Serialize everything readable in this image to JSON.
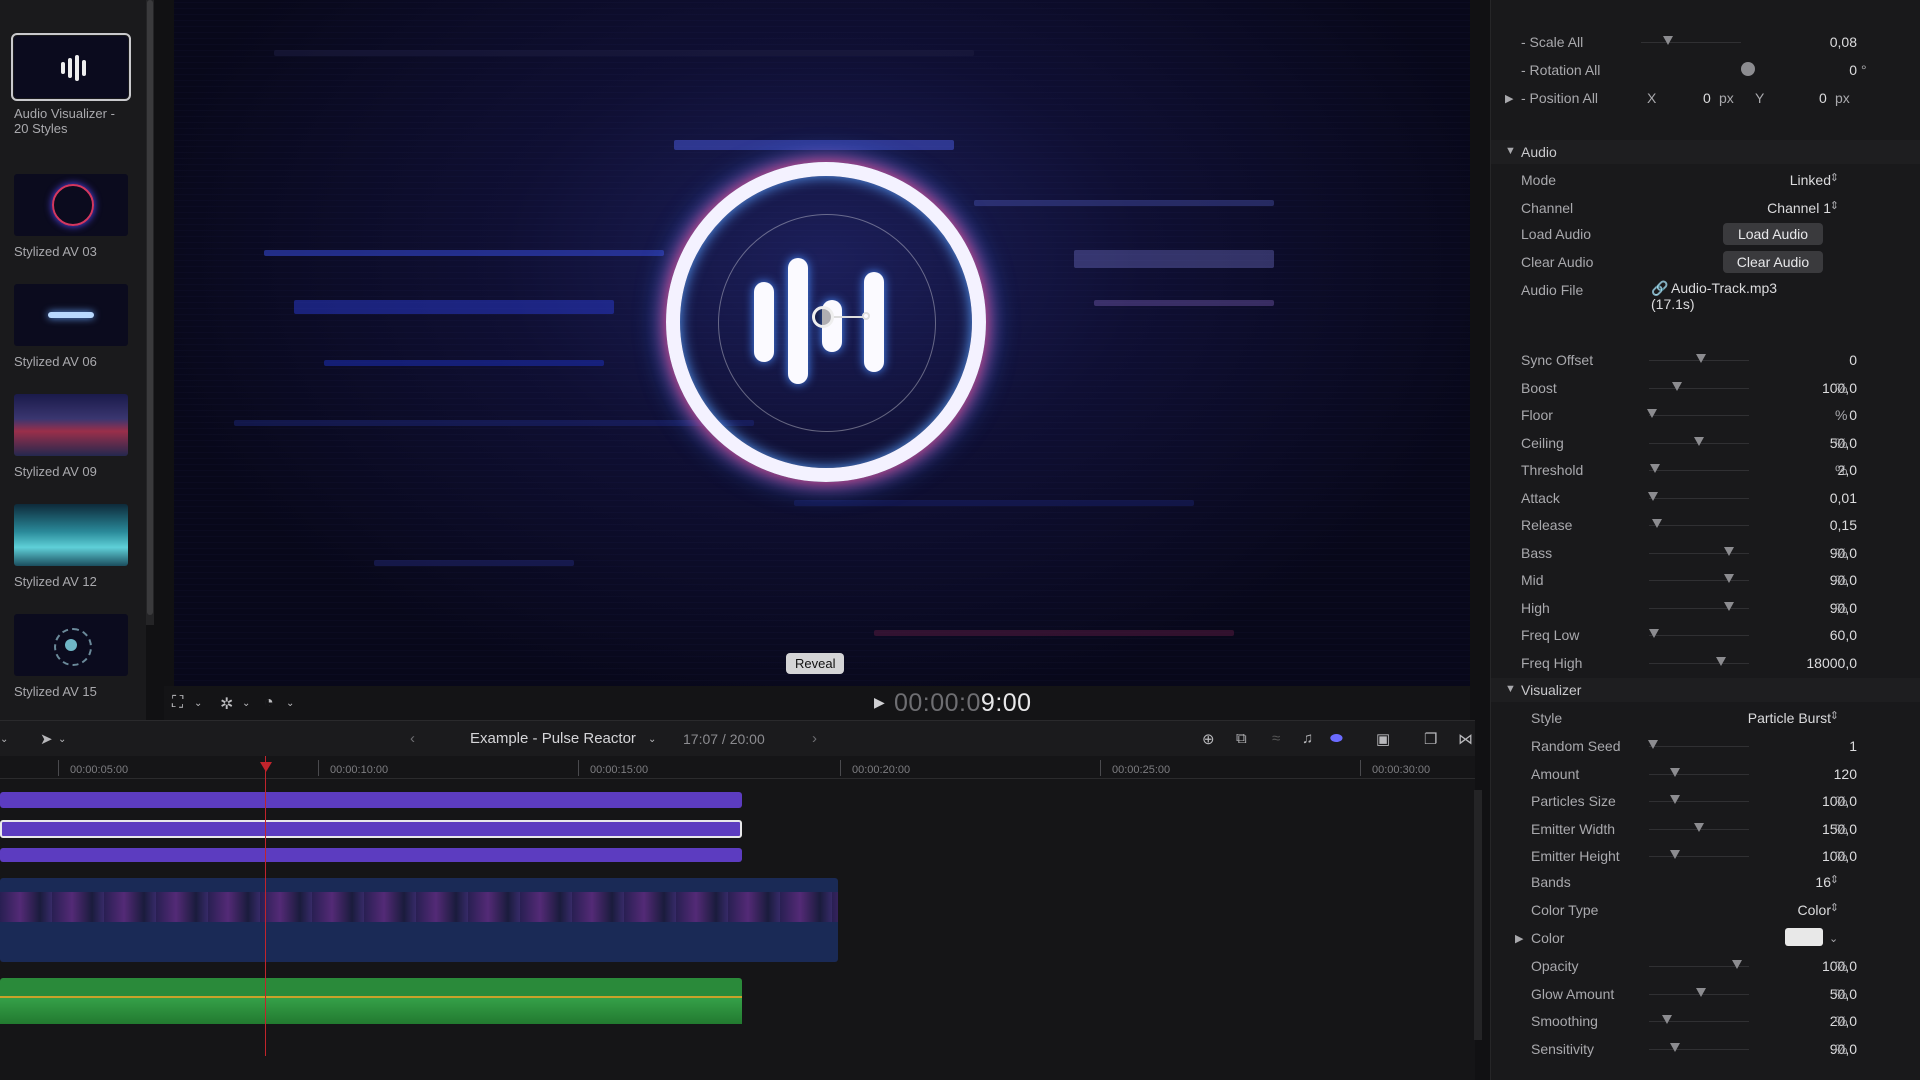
{
  "browser": {
    "items": [
      {
        "label": "Audio Visualizer - 20 Styles"
      },
      {
        "label": "Stylized AV 03"
      },
      {
        "label": "Stylized AV 06"
      },
      {
        "label": "Stylized AV 09"
      },
      {
        "label": "Stylized AV 12"
      },
      {
        "label": "Stylized AV 15"
      }
    ]
  },
  "viewer": {
    "reveal_label": "Reveal",
    "timecode_dim": "00:00:0",
    "timecode_bright": "9:00"
  },
  "timeline_toolbar": {
    "project_name": "Example - Pulse Reactor",
    "duration": "17:07 / 20:00"
  },
  "timeline": {
    "ruler": [
      "00:00:05:00",
      "00:00:10:00",
      "00:00:15:00",
      "00:00:20:00",
      "00:00:25:00",
      "00:00:30:00"
    ]
  },
  "inspector": {
    "top_rows": [
      {
        "label": "- Scale All",
        "value": "0,08",
        "unit": ""
      },
      {
        "label": "- Rotation All",
        "value": "0",
        "unit": "°"
      }
    ],
    "position_all": {
      "label": "- Position All",
      "x_label": "X",
      "x_value": "0",
      "x_unit": "px",
      "y_label": "Y",
      "y_value": "0",
      "y_unit": "px"
    },
    "audio": {
      "title": "Audio",
      "mode": {
        "label": "Mode",
        "value": "Linked"
      },
      "channel": {
        "label": "Channel",
        "value": "Channel 1"
      },
      "load_audio": {
        "label": "Load Audio",
        "button": "Load Audio"
      },
      "clear_audio": {
        "label": "Clear Audio",
        "button": "Clear Audio"
      },
      "audio_file": {
        "label": "Audio File",
        "value": "Audio-Track.mp3",
        "duration": "(17.1s)"
      },
      "params": [
        {
          "label": "Sync Offset",
          "value": "0",
          "unit": ""
        },
        {
          "label": "Boost",
          "value": "100,0",
          "unit": "%"
        },
        {
          "label": "Floor",
          "value": "0",
          "unit": "%"
        },
        {
          "label": "Ceiling",
          "value": "50,0",
          "unit": "%"
        },
        {
          "label": "Threshold",
          "value": "2,0",
          "unit": "%"
        },
        {
          "label": "Attack",
          "value": "0,01",
          "unit": ""
        },
        {
          "label": "Release",
          "value": "0,15",
          "unit": ""
        },
        {
          "label": "Bass",
          "value": "90,0",
          "unit": "%"
        },
        {
          "label": "Mid",
          "value": "90,0",
          "unit": "%"
        },
        {
          "label": "High",
          "value": "90,0",
          "unit": "%"
        },
        {
          "label": "Freq Low",
          "value": "60,0",
          "unit": ""
        },
        {
          "label": "Freq High",
          "value": "18000,0",
          "unit": ""
        }
      ]
    },
    "visualizer": {
      "title": "Visualizer",
      "style": {
        "label": "Style",
        "value": "Particle Burst"
      },
      "params": [
        {
          "label": "Random Seed",
          "value": "1",
          "unit": ""
        },
        {
          "label": "Amount",
          "value": "120",
          "unit": ""
        },
        {
          "label": "Particles Size",
          "value": "100,0",
          "unit": "%"
        },
        {
          "label": "Emitter Width",
          "value": "150,0",
          "unit": "%"
        },
        {
          "label": "Emitter Height",
          "value": "100,0",
          "unit": "%"
        }
      ],
      "bands": {
        "label": "Bands",
        "value": "16"
      },
      "color_type": {
        "label": "Color Type",
        "value": "Color"
      },
      "color": {
        "label": "Color",
        "swatch": "#e8e8e8"
      },
      "params2": [
        {
          "label": "Opacity",
          "value": "100,0",
          "unit": "%"
        },
        {
          "label": "Glow Amount",
          "value": "50,0",
          "unit": "%"
        },
        {
          "label": "Smoothing",
          "value": "20,0",
          "unit": "%"
        },
        {
          "label": "Sensitivity",
          "value": "90,0",
          "unit": "%"
        }
      ]
    }
  }
}
